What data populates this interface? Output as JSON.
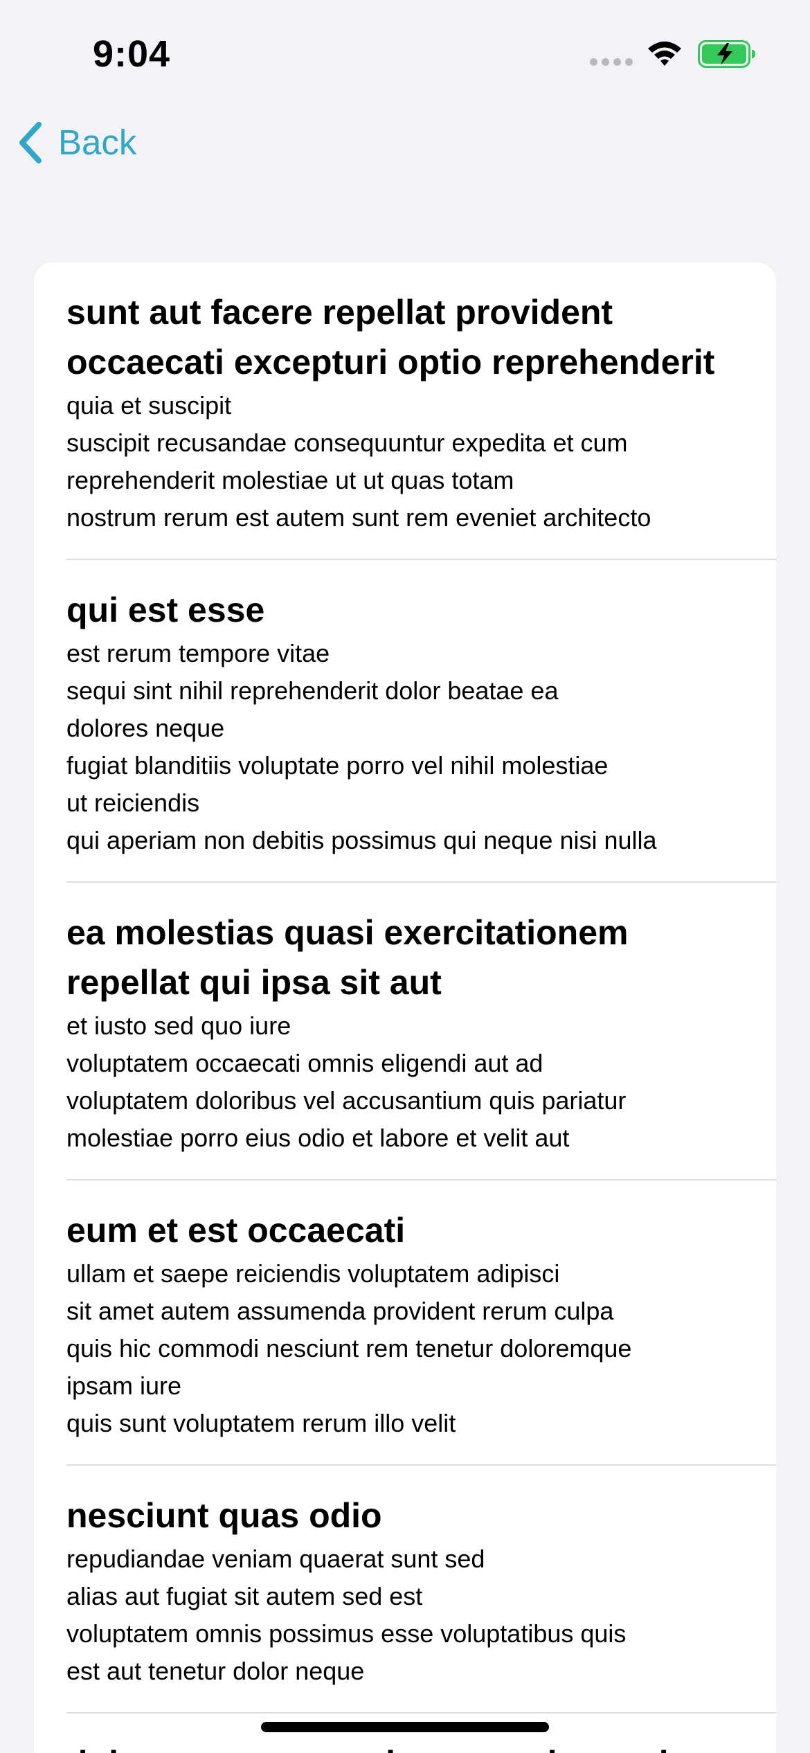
{
  "status_bar": {
    "time": "9:04",
    "icons": [
      "cellular-signal-icon",
      "wifi-icon",
      "battery-charging-icon"
    ],
    "battery_color": "#34c759"
  },
  "nav": {
    "back_label": "Back",
    "accent_color": "#30a7c7"
  },
  "posts": [
    {
      "title": "sunt aut facere repellat provident\noccaecati excepturi optio reprehenderit",
      "body": "quia et suscipit\nsuscipit recusandae consequuntur expedita et cum\nreprehenderit molestiae ut ut quas totam\nnostrum rerum est autem sunt rem eveniet architecto"
    },
    {
      "title": "qui est esse",
      "body": "est rerum tempore vitae\nsequi sint nihil reprehenderit dolor beatae ea\ndolores neque\nfugiat blanditiis voluptate porro vel nihil molestiae\nut reiciendis\nqui aperiam non debitis possimus qui neque nisi nulla"
    },
    {
      "title": "ea molestias quasi exercitationem\nrepellat qui ipsa sit aut",
      "body": "et iusto sed quo iure\nvoluptatem occaecati omnis eligendi aut ad\nvoluptatem doloribus vel accusantium quis pariatur\nmolestiae porro eius odio et labore et velit aut"
    },
    {
      "title": "eum et est occaecati",
      "body": "ullam et saepe reiciendis voluptatem adipisci\nsit amet autem assumenda provident rerum culpa\nquis hic commodi nesciunt rem tenetur doloremque\nipsam iure\nquis sunt voluptatem rerum illo velit"
    },
    {
      "title": "nesciunt quas odio",
      "body": "repudiandae veniam quaerat sunt sed\nalias aut fugiat sit autem sed est\nvoluptatem omnis possimus esse voluptatibus quis\nest aut tenetur dolor neque"
    },
    {
      "title": "dolorem eum magni eos aperiam quia",
      "body": ""
    }
  ]
}
